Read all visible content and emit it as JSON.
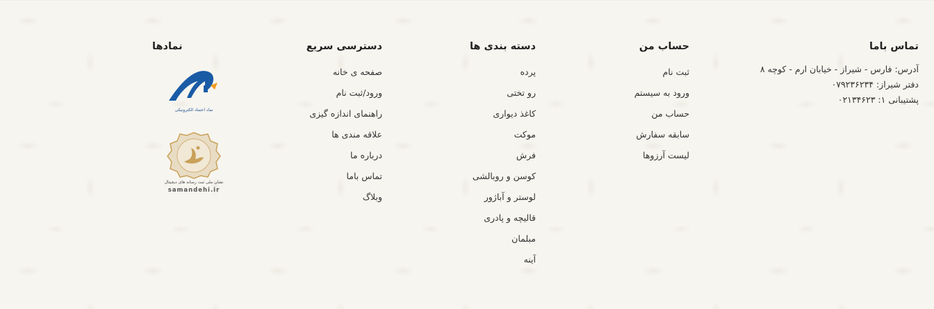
{
  "contact": {
    "title": "تماس باما",
    "address": "آدرس: فارس - شیراز - خیابان ارم - کوچه ۸",
    "office": "دفتر شیراز: ۰۷۹۲۳۶۲۳۴",
    "support": "پشتیبانی ۱: ۰۲۱۳۴۶۲۳"
  },
  "account": {
    "title": "حساب من",
    "items": [
      "ثبت نام",
      "ورود به سیستم",
      "حساب من",
      "سابقه سفارش",
      "لیست آرزوها"
    ]
  },
  "categories": {
    "title": "دسته بندی ها",
    "items": [
      "پرده",
      "رو تختی",
      "کاغذ دیواری",
      "موکت",
      "فرش",
      "کوسن و روبالشی",
      "لوستر و آباژور",
      "قالیچه و پادری",
      "مبلمان",
      "آینه"
    ]
  },
  "quick": {
    "title": "دسترسی سریع",
    "items": [
      "صفحه ی خانه",
      "ورود/ثبت نام",
      "راهنمای اندازه گیزی",
      "علاقه مندی ها",
      "درباره ما",
      "تماس باما",
      "وبلاگ"
    ]
  },
  "badges": {
    "title": "نمادها",
    "enamad_label": "نماد اعتماد الکترونیکی",
    "samandehi_label": "نشان ملی ثبت رسانه های دیجیتال",
    "samandehi_url": "samandehi.ir",
    "enamad_color": "#1a5ba6",
    "samandehi_color": "#c9a15a"
  }
}
